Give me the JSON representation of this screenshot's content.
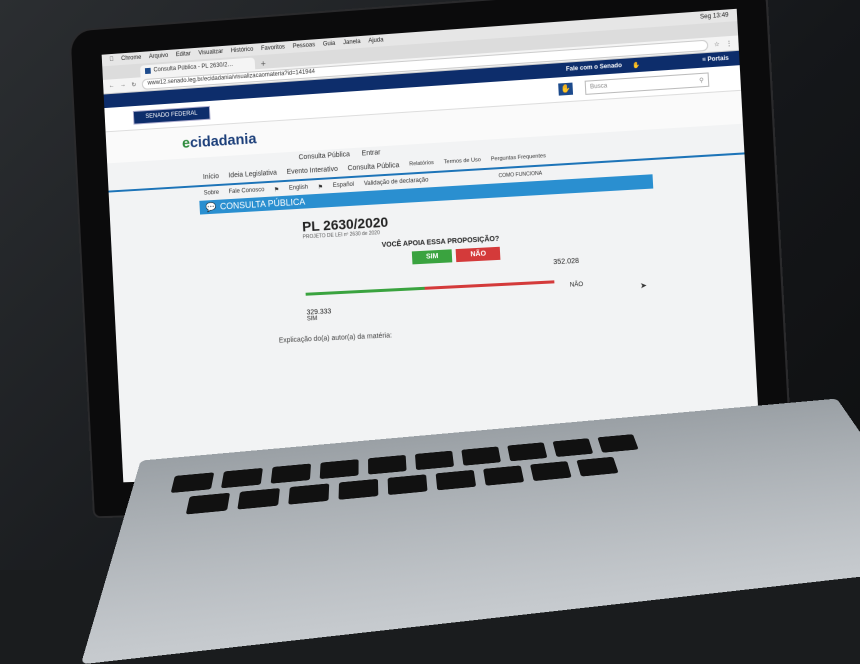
{
  "menubar": {
    "apple": "",
    "app": "Chrome",
    "items": [
      "Arquivo",
      "Editar",
      "Visualizar",
      "Histórico",
      "Favoritos",
      "Pessoas",
      "Guia",
      "Janela",
      "Ajuda"
    ],
    "clock": "Seg 13:49"
  },
  "browser": {
    "tab_title": "Consulta Pública - PL 2630/2…",
    "new_tab": "+",
    "url": "www12.senado.leg.br/ecidadania/visualizacaomateria?id=141944"
  },
  "senado": {
    "fale": "Fale com o Senado",
    "portais": "≡ Portais",
    "button": "SENADO FEDERAL",
    "search_placeholder": "Busca"
  },
  "ecidadania": {
    "logo_e": "e",
    "logo_rest": "cidadania",
    "nav_top": [
      "Consulta Pública",
      "Entrar"
    ],
    "nav_main": [
      "Início",
      "Ideia Legislativa",
      "Evento Interativo",
      "Consulta Pública"
    ],
    "nav_right": [
      "Relatórios",
      "Termos de Uso",
      "Perguntas Frequentes"
    ],
    "nav_sub": [
      "Sobre",
      "Fale Conosco",
      "English",
      "Español",
      "Validação de declaração"
    ],
    "como": "COMO FUNCIONA"
  },
  "consulta": {
    "banner": "CONSULTA PÚBLICA",
    "title": "PL 2630/2020",
    "subtitle": "PROJETO DE LEI nº 2630 de 2020",
    "question": "VOCÊ APOIA ESSA PROPOSIÇÃO?",
    "sim_btn": "SIM",
    "nao_btn": "NÃO",
    "nao_count": "352.028",
    "nao_label": "NÃO",
    "sim_count": "329.333",
    "sim_label": "SIM",
    "sim_share": 0.483,
    "explicacao": "Explicação do(a) autor(a) da matéria:"
  }
}
